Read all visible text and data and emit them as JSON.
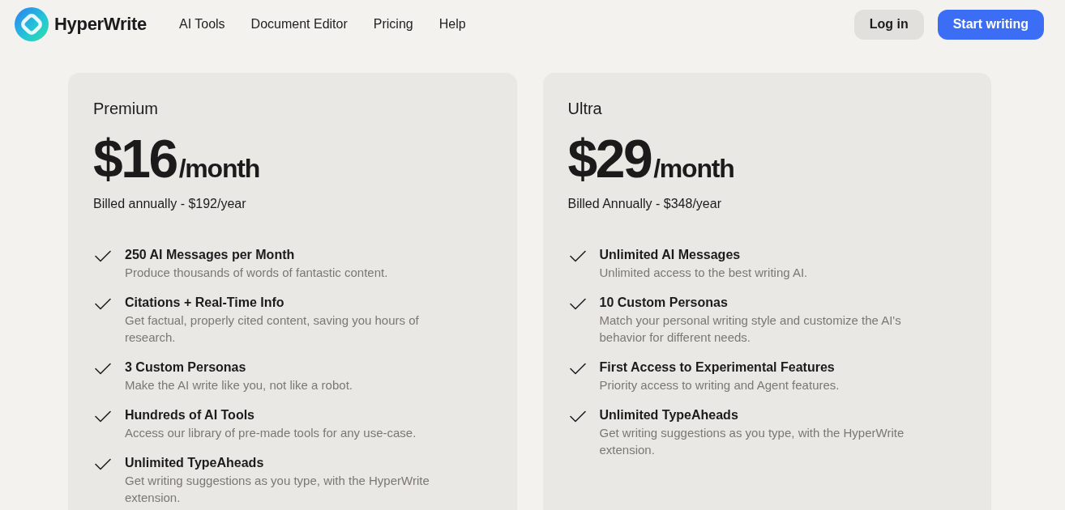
{
  "brand": {
    "name": "HyperWrite"
  },
  "nav": {
    "links": [
      "AI Tools",
      "Document Editor",
      "Pricing",
      "Help"
    ],
    "buttons": [
      {
        "label": "Log in",
        "kind": "secondary"
      },
      {
        "label": "Start writing",
        "kind": "primary"
      }
    ]
  },
  "plans": [
    {
      "name": "Premium",
      "price": "$16",
      "period": "/month",
      "billing": "Billed annually - $192/year",
      "features": [
        {
          "title": "250 AI Messages per Month",
          "description": "Produce thousands of words of fantastic content."
        },
        {
          "title": "Citations + Real-Time Info",
          "description": "Get factual, properly cited content, saving you hours of research."
        },
        {
          "title": "3 Custom Personas",
          "description": "Make the AI write like you, not like a robot."
        },
        {
          "title": "Hundreds of AI Tools",
          "description": "Access our library of pre-made tools for any use-case."
        },
        {
          "title": "Unlimited TypeAheads",
          "description": "Get writing suggestions as you type, with the HyperWrite extension."
        }
      ]
    },
    {
      "name": "Ultra",
      "price": "$29",
      "period": "/month",
      "billing": "Billed Annually - $348/year",
      "features": [
        {
          "title": "Unlimited AI Messages",
          "description": "Unlimited access to the best writing AI."
        },
        {
          "title": "10 Custom Personas",
          "description": "Match your personal writing style and customize the AI's behavior for different needs."
        },
        {
          "title": "First Access to Experimental Features",
          "description": "Priority access to writing and Agent features."
        },
        {
          "title": "Unlimited TypeAheads",
          "description": "Get writing suggestions as you type, with the HyperWrite extension."
        }
      ]
    }
  ]
}
